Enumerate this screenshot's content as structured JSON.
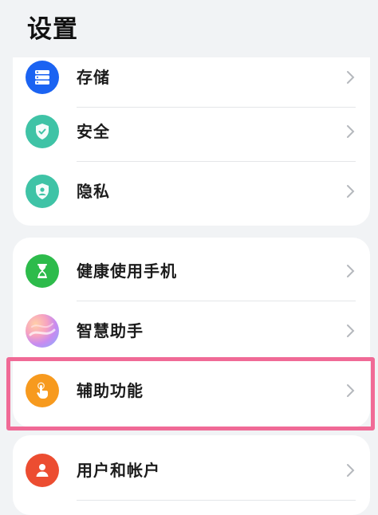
{
  "header": {
    "title": "设置"
  },
  "sections": [
    {
      "items": [
        {
          "label": "存储",
          "icon": "storage-icon",
          "icon_color": "#1b63f2"
        },
        {
          "label": "安全",
          "icon": "security-shield-icon",
          "icon_color": "#3fc3a6"
        },
        {
          "label": "隐私",
          "icon": "privacy-icon",
          "icon_color": "#3fc3a6"
        }
      ]
    },
    {
      "items": [
        {
          "label": "健康使用手机",
          "icon": "hourglass-icon",
          "icon_color": "#2dbb4b"
        },
        {
          "label": "智慧助手",
          "icon": "smart-assistant-icon",
          "icon_color": "#c88bf0"
        },
        {
          "label": "辅助功能",
          "icon": "accessibility-hand-icon",
          "icon_color": "#f79a1e"
        }
      ]
    },
    {
      "items": [
        {
          "label": "用户和帐户",
          "icon": "user-icon",
          "icon_color": "#ec4d31"
        }
      ]
    }
  ],
  "highlight": {
    "target": "辅助功能",
    "color": "#f06a96"
  }
}
